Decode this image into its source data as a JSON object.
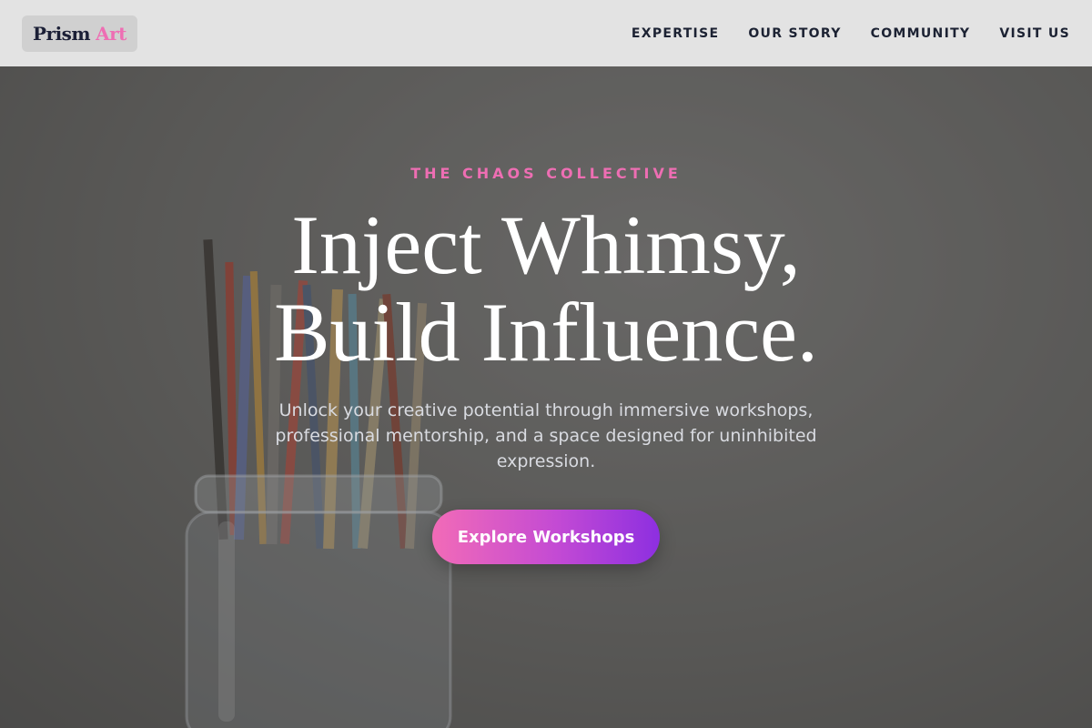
{
  "header": {
    "logo": {
      "primary": "Prism",
      "accent": "Art"
    },
    "nav": [
      {
        "label": "EXPERTISE"
      },
      {
        "label": "OUR STORY"
      },
      {
        "label": "COMMUNITY"
      },
      {
        "label": "VISIT US"
      }
    ]
  },
  "hero": {
    "eyebrow": "THE CHAOS COLLECTIVE",
    "headline_line1": "Inject Whimsy,",
    "headline_line2": "Build Influence.",
    "subtext": "Unlock your creative potential through immersive workshops, professional mentorship, and a space designed for uninhibited expression.",
    "cta_label": "Explore Workshops",
    "background_image": "paintbrushes-in-glass-jar"
  },
  "colors": {
    "accent_pink": "#ee6eb3",
    "cta_gradient_start": "#f26bb7",
    "cta_gradient_end": "#8d2fe0",
    "header_bg": "#e3e3e3"
  }
}
